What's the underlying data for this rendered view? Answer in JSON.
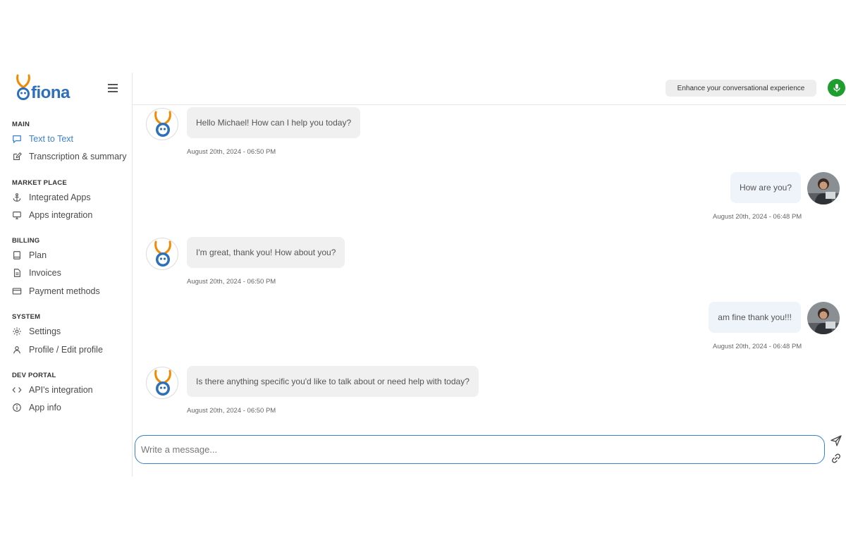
{
  "brand": {
    "logo_text": "fiona"
  },
  "sidebar": {
    "sections": [
      {
        "title": "MAIN",
        "items": [
          {
            "label": "Text to Text",
            "icon": "message-square-icon",
            "active": true
          },
          {
            "label": "Transcription & summary",
            "icon": "edit-icon"
          }
        ]
      },
      {
        "title": "MARKET PLACE",
        "items": [
          {
            "label": "Integrated Apps",
            "icon": "anchor-icon"
          },
          {
            "label": "Apps integration",
            "icon": "monitor-icon"
          }
        ]
      },
      {
        "title": "BILLING",
        "items": [
          {
            "label": "Plan",
            "icon": "book-icon"
          },
          {
            "label": "Invoices",
            "icon": "file-text-icon"
          },
          {
            "label": "Payment methods",
            "icon": "credit-card-icon"
          }
        ]
      },
      {
        "title": "SYSTEM",
        "items": [
          {
            "label": "Settings",
            "icon": "gear-icon"
          },
          {
            "label": "Profile / Edit profile",
            "icon": "user-icon"
          }
        ]
      },
      {
        "title": "DEV PORTAL",
        "items": [
          {
            "label": "API's integration",
            "icon": "code-icon"
          },
          {
            "label": "App info",
            "icon": "info-icon"
          }
        ]
      }
    ]
  },
  "topbar": {
    "enhance_label": "Enhance your conversational experience",
    "mic_icon": "microphone-icon"
  },
  "messages": [
    {
      "from": "bot",
      "text": "Hello Michael! How can I help you today?",
      "time": "August 20th, 2024 - 06:50 PM"
    },
    {
      "from": "user",
      "text": "How are you?",
      "time": "August 20th, 2024 - 06:48 PM"
    },
    {
      "from": "bot",
      "text": "I'm great, thank you! How about you?",
      "time": "August 20th, 2024 - 06:50 PM"
    },
    {
      "from": "user",
      "text": "am fine thank you!!!",
      "time": "August 20th, 2024 - 06:48 PM"
    },
    {
      "from": "bot",
      "text": "Is there anything specific you'd like to talk about or need help with today?",
      "time": "August 20th, 2024 - 06:50 PM"
    }
  ],
  "composer": {
    "placeholder": "Write a message...",
    "value": ""
  },
  "colors": {
    "accent": "#3b7fd1",
    "mic": "#1f9d2e",
    "logo_orange": "#f08a00",
    "logo_blue": "#2d6fb8"
  }
}
